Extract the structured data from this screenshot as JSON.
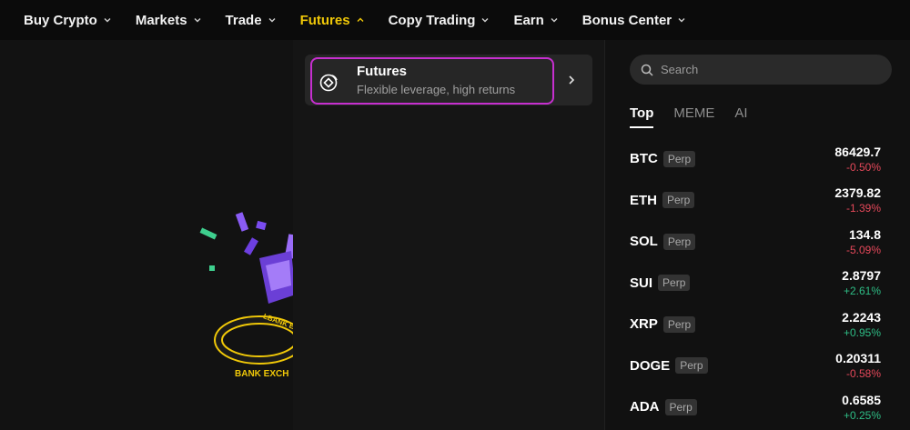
{
  "nav": {
    "items": [
      {
        "label": "Buy Crypto",
        "active": false
      },
      {
        "label": "Markets",
        "active": false
      },
      {
        "label": "Trade",
        "active": false
      },
      {
        "label": "Futures",
        "active": true
      },
      {
        "label": "Copy Trading",
        "active": false
      },
      {
        "label": "Earn",
        "active": false
      },
      {
        "label": "Bonus Center",
        "active": false
      }
    ]
  },
  "dropdown": {
    "title": "Futures",
    "subtitle": "Flexible leverage, high returns",
    "icon": "futures-icon"
  },
  "artwork": {
    "banner_text": "BANK EXCH",
    "ring_text": "LBANK E"
  },
  "colors": {
    "accent": "#f0c808",
    "highlight": "#c62fcf",
    "down": "#e5485a",
    "up": "#2ebd85"
  },
  "markets": {
    "search_placeholder": "Search",
    "tabs": [
      "Top",
      "MEME",
      "AI"
    ],
    "rows": [
      {
        "symbol": "BTC",
        "badge": "Perp",
        "price": "86429.7",
        "change": "-0.50%",
        "dir": "down"
      },
      {
        "symbol": "ETH",
        "badge": "Perp",
        "price": "2379.82",
        "change": "-1.39%",
        "dir": "down"
      },
      {
        "symbol": "SOL",
        "badge": "Perp",
        "price": "134.8",
        "change": "-5.09%",
        "dir": "down"
      },
      {
        "symbol": "SUI",
        "badge": "Perp",
        "price": "2.8797",
        "change": "+2.61%",
        "dir": "up"
      },
      {
        "symbol": "XRP",
        "badge": "Perp",
        "price": "2.2243",
        "change": "+0.95%",
        "dir": "up"
      },
      {
        "symbol": "DOGE",
        "badge": "Perp",
        "price": "0.20311",
        "change": "-0.58%",
        "dir": "down"
      },
      {
        "symbol": "ADA",
        "badge": "Perp",
        "price": "0.6585",
        "change": "+0.25%",
        "dir": "up"
      }
    ]
  }
}
